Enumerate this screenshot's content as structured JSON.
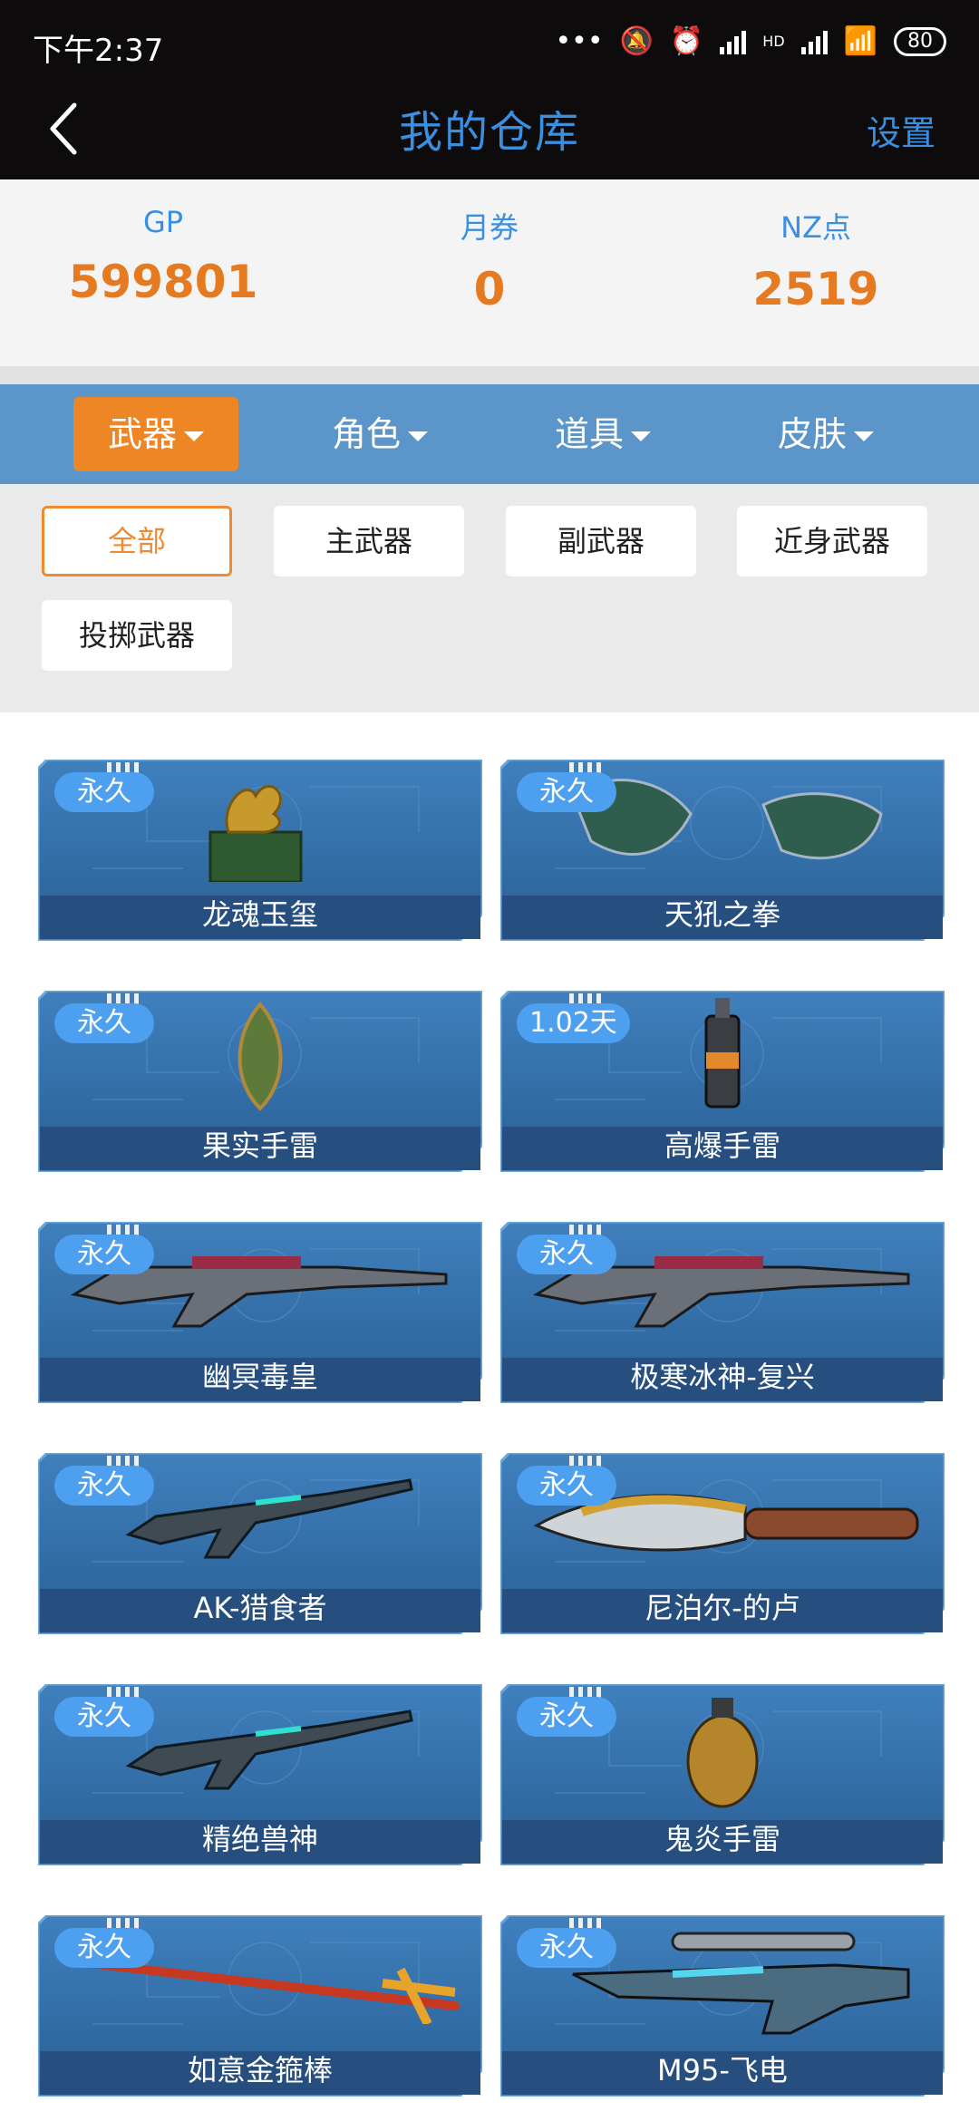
{
  "status": {
    "time": "下午2:37",
    "battery": "80",
    "net": "HD"
  },
  "header": {
    "title": "我的仓库",
    "settings_label": "设置"
  },
  "currency": [
    {
      "label": "GP",
      "value": "599801"
    },
    {
      "label": "月券",
      "value": "0"
    },
    {
      "label": "NZ点",
      "value": "2519"
    }
  ],
  "tabs": [
    {
      "label": "武器",
      "active": true
    },
    {
      "label": "角色",
      "active": false
    },
    {
      "label": "道具",
      "active": false
    },
    {
      "label": "皮肤",
      "active": false
    }
  ],
  "filters": [
    {
      "label": "全部",
      "active": true
    },
    {
      "label": "主武器",
      "active": false
    },
    {
      "label": "副武器",
      "active": false
    },
    {
      "label": "近身武器",
      "active": false
    },
    {
      "label": "投掷武器",
      "active": false
    }
  ],
  "items": [
    {
      "name": "龙魂玉玺",
      "duration": "永久",
      "icon": "dragon-seal-icon"
    },
    {
      "name": "天犼之拳",
      "duration": "永久",
      "icon": "gauntlets-icon"
    },
    {
      "name": "果实手雷",
      "duration": "永久",
      "icon": "fruit-grenade-icon"
    },
    {
      "name": "高爆手雷",
      "duration": "1.02天",
      "icon": "he-grenade-icon"
    },
    {
      "name": "幽冥毒皇",
      "duration": "永久",
      "icon": "rifle-icon"
    },
    {
      "name": "极寒冰神-复兴",
      "duration": "永久",
      "icon": "rifle-icon"
    },
    {
      "name": "AK-猎食者",
      "duration": "永久",
      "icon": "ak-rifle-icon"
    },
    {
      "name": "尼泊尔-的卢",
      "duration": "永久",
      "icon": "kukri-knife-icon"
    },
    {
      "name": "精绝兽神",
      "duration": "永久",
      "icon": "ak-rifle-icon"
    },
    {
      "name": "鬼炎手雷",
      "duration": "永久",
      "icon": "grenade-icon"
    },
    {
      "name": "如意金箍棒",
      "duration": "永久",
      "icon": "golden-staff-icon"
    },
    {
      "name": "M95-飞电",
      "duration": "永久",
      "icon": "sniper-rifle-icon"
    }
  ],
  "colors": {
    "accent": "#ef8626",
    "blue": "#3b8fe0",
    "tabbar": "#5b95c9",
    "card": "#2e6aa5"
  }
}
